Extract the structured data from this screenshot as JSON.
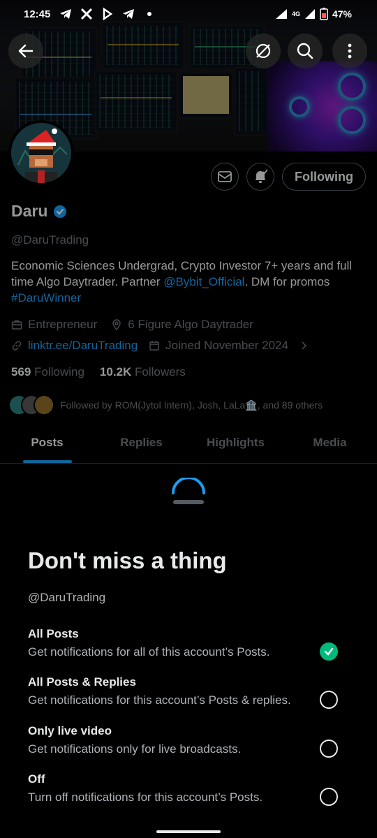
{
  "status_bar": {
    "time": "12:45",
    "network": "4G",
    "battery": "47%"
  },
  "profile": {
    "name": "Daru",
    "handle": "@DaruTrading",
    "bio_prefix": "Economic Sciences Undergrad, Crypto Investor 7+ years and full time Algo Daytrader. Partner ",
    "bio_mention": "@Bybit_Official",
    "bio_mid": ". DM for promos ",
    "bio_hashtag": "#DaruWinner",
    "category": "Entrepreneur",
    "location": "6 Figure Algo Daytrader",
    "website": "linktr.ee/DaruTrading",
    "joined": "Joined November 2024",
    "following_count": "569",
    "following_label": "Following",
    "followers_count": "10.2K",
    "followers_label": "Followers",
    "followed_by": "Followed by ROM(Jytol Intern), Josh, LaLa🏦, and 89 others",
    "following_button": "Following"
  },
  "tabs": [
    {
      "label": "Posts",
      "active": true
    },
    {
      "label": "Replies",
      "active": false
    },
    {
      "label": "Highlights",
      "active": false
    },
    {
      "label": "Media",
      "active": false
    }
  ],
  "sheet": {
    "title": "Don't miss a thing",
    "handle": "@DaruTrading",
    "options": [
      {
        "title": "All Posts",
        "desc": "Get notifications for all of this account’s Posts.",
        "selected": true
      },
      {
        "title": "All Posts & Replies",
        "desc": "Get notifications for this account’s Posts & replies.",
        "selected": false
      },
      {
        "title": "Only live video",
        "desc": "Get notifications only for live broadcasts.",
        "selected": false
      },
      {
        "title": "Off",
        "desc": "Turn off notifications for this account’s Posts.",
        "selected": false
      }
    ]
  },
  "colors": {
    "accent": "#1d9bf0",
    "selected": "#00ba7c",
    "muted": "#71767b"
  }
}
